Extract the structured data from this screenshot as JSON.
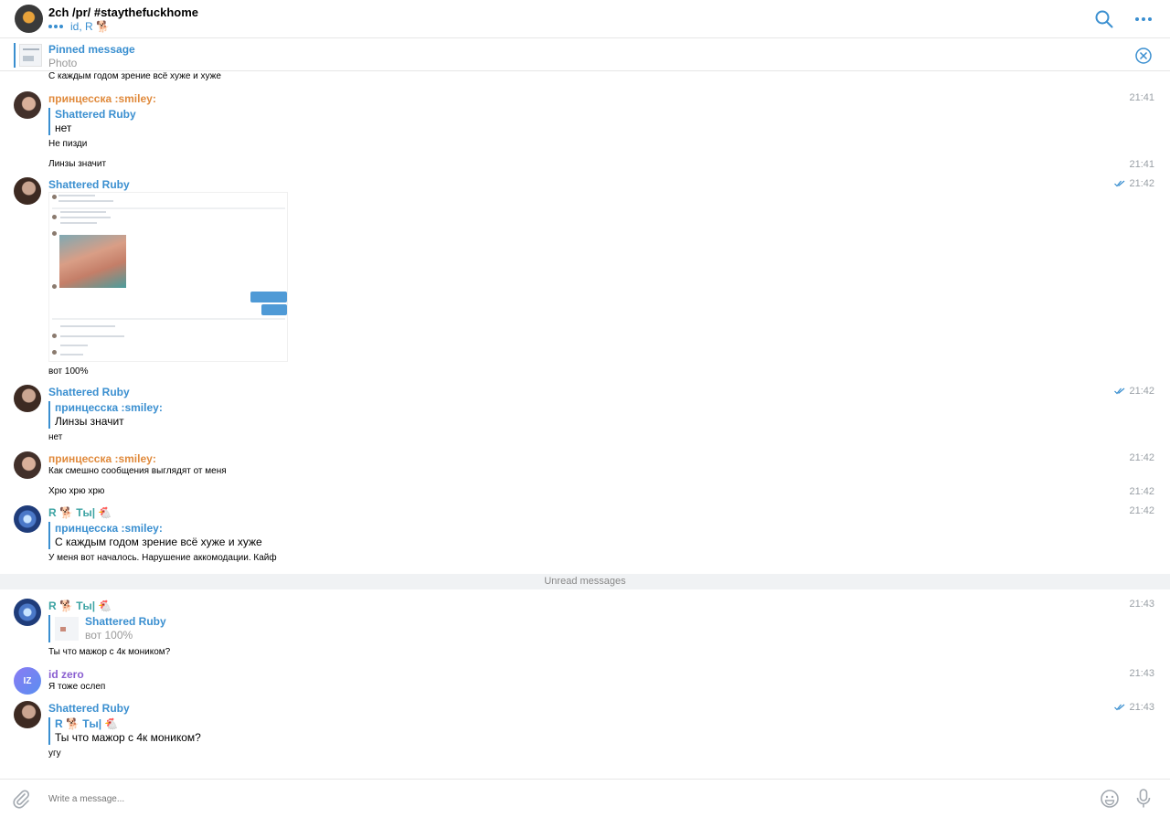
{
  "header": {
    "title": "2ch /pr/ #staythefuckhome",
    "subtitle": "id, R 🐕"
  },
  "pinned": {
    "title": "Pinned message",
    "subtitle": "Photo",
    "preview_text": "С каждым годом зрение всё хуже и хуже"
  },
  "messages": [
    {
      "sender": "принцесска :smiley:",
      "time": "21:41",
      "reply": {
        "name": "Shattered Ruby",
        "text": "нет"
      },
      "text": "Не пизди"
    },
    {
      "text": "Линзы значит",
      "time": "21:41"
    },
    {
      "sender": "Shattered Ruby",
      "time": "21:42",
      "text": "вот 100%"
    },
    {
      "sender": "Shattered Ruby",
      "time": "21:42",
      "reply": {
        "name": "принцесска :smiley:",
        "text": "Линзы значит"
      },
      "text": "нет"
    },
    {
      "sender": "принцесска :smiley:",
      "time": "21:42",
      "text": "Как смешно сообщения выглядят от меня"
    },
    {
      "text": "Хрю хрю хрю",
      "time": "21:42"
    },
    {
      "sender": "R 🐕 Ты| 🐔",
      "time": "21:42",
      "reply": {
        "name": "принцесска :smiley:",
        "text": "С каждым годом зрение всё хуже и хуже"
      },
      "text": "У меня вот началось. Нарушение аккомодации. Кайф"
    },
    {
      "sender": "R 🐕 Ты| 🐔",
      "time": "21:43",
      "reply": {
        "name": "Shattered Ruby",
        "text": "вот 100%"
      },
      "text": "Ты что мажор с 4к моником?"
    },
    {
      "sender": "id zero",
      "avatar_initials": "IZ",
      "time": "21:43",
      "text": "Я тоже ослеп"
    },
    {
      "sender": "Shattered Ruby",
      "time": "21:43",
      "reply": {
        "name": "R 🐕 Ты| 🐔",
        "text": "Ты что мажор с 4к моником?"
      },
      "text": "угу"
    }
  ],
  "unread_label": "Unread messages",
  "composer": {
    "placeholder": "Write a message..."
  },
  "colors": {
    "accent": "#3a8fd0",
    "sender_orange": "#e08a3c",
    "sender_teal": "#3ca3a3",
    "sender_purple": "#8a5fd0"
  },
  "icons": [
    "search-icon",
    "more-icon",
    "close-circle-icon",
    "attach-icon",
    "emoji-icon",
    "mic-icon",
    "double-check-icon"
  ]
}
